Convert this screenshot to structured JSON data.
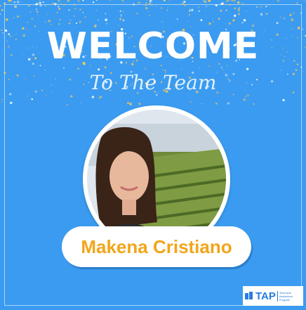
{
  "header": {
    "title": "WELCOME",
    "subtitle": "To The Team"
  },
  "member": {
    "name": "Makena Cristiano"
  },
  "logo": {
    "text": "TAP",
    "tagline_lines": [
      "Technical",
      "Assistance",
      "Program"
    ]
  },
  "colors": {
    "background": "#3a9bf0",
    "name_text": "#f2a51a",
    "confetti_gold": "#e8c46a"
  }
}
